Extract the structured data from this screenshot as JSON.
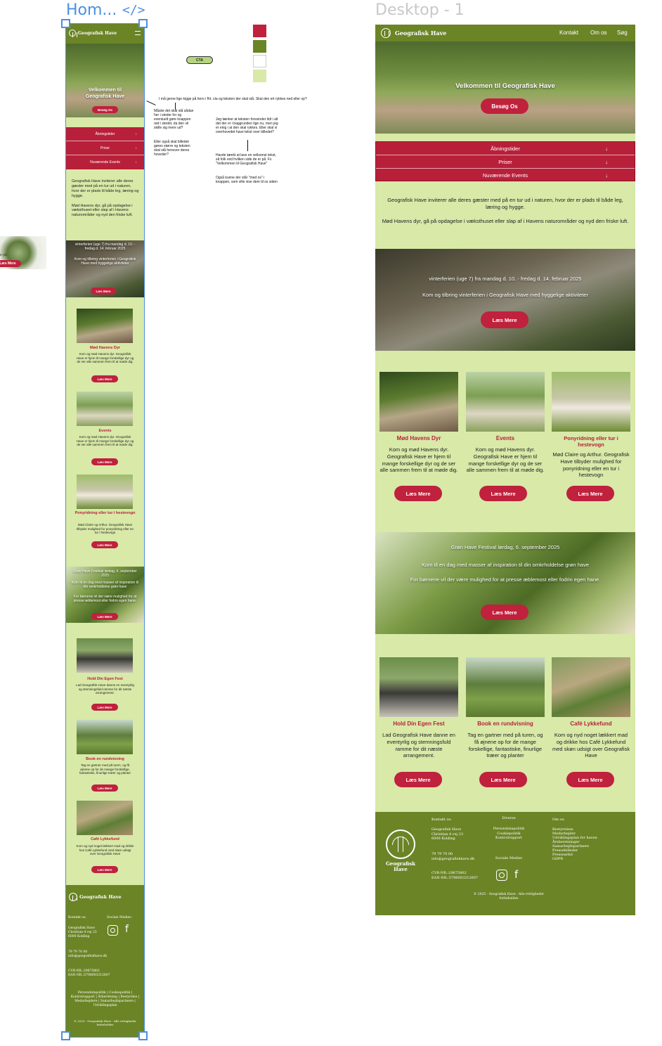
{
  "canvas": {
    "mobile_frame_title": "Hom...",
    "code_icon": "</>",
    "desktop_frame_title": "Desktop - 1",
    "cta_label": "CTA",
    "swatches": [
      "#c0213d",
      "#6b8426",
      "#ffffff",
      "#d8e9a8"
    ],
    "side_thumb_text": "e på",
    "side_thumb_btn": "Læs Mere",
    "notes": {
      "n1": "I må gerne lige kigge på hero i fht. cta og teksten der skal stå. Skal den ert rykkes ned eller op?",
      "n2": "Måske det skal stå sådan her i steder for og eventuelt gøre knappen rød i stedet, da den vil skille sig mere ud?",
      "n3": "Eller også skal billedet gøres større og teksten skal stå henover deres hoveder?",
      "n4": "Jeg tænker at teksten forsvinder lidt i alt det der er i baggrunden lige nu, men jeg er enig i at den skal rykkes. Eller skal vi overhovedet have tekst over billedet?",
      "n5": "Havde tænkt at lave en velkomst tekst, så folk ved hvilken side de er på. Fx \"Velkommen til Geografisk Have\"",
      "n6": "Også kunne der står \"med os\" i knappen, som ville vise dem til os siden"
    }
  },
  "site": {
    "name": "Geografisk Have",
    "nav": [
      "Kontakt",
      "Om os",
      "Søg"
    ],
    "hero_title": "Velkommen til Geografisk Have",
    "hero_button": "Besøg Os",
    "accordions": [
      "Åbningstider",
      "Priser",
      "Nuværende Events"
    ],
    "accordion_arrow": "↓",
    "intro_p1": "Geografisk Have inviterer alle deres gæster med på en tur ud i naturen, hvor der er plads til både leg, læring og hygge.",
    "intro_p2": "Mød Havens dyr, gå på opdagelse i væksthuset eller slap af i Havens naturområder og nyd den friske luft.",
    "banner1": {
      "line1": "vinterferien (uge 7) fra mandag d. 10. - fredag d. 14. februar 2025",
      "line2": "Kom og tilbring vinterferien i Geografisk Have med hyggelige aktiviteter",
      "button": "Læs Mere"
    },
    "banner2": {
      "line1": "Grøn Have Festival lørdag, 6. september 2025",
      "line2": "Kom til en dag med masser af inspiration til din omkrholdelse grøn have",
      "line3": "For børnene vil der være mulighed for at presse æblemost eller fodrin egen hane.",
      "button": "Læs Mere"
    },
    "cards_row1": [
      {
        "title": "Mød Havens Dyr",
        "text": "Kom og mød Havens dyr. Geografisk Have er hjem til mange forskellige dyr og de ser alle sammen frem til at møde dig.",
        "button": "Læs Mere"
      },
      {
        "title": "Events",
        "text": "Kom og mød Havens dyr. Geografisk Have er hjem til mange forskellige dyr og de ser alle sammen frem til at møde dig.",
        "button": "Læs Mere"
      },
      {
        "title": "Ponyridning eller tur i hestevogn",
        "text": "Mød Claire og Arthur. Geografisk Have tilbyder mulighed for ponyridning eller en tur i hestevogn",
        "button": "Læs Mere"
      }
    ],
    "cards_row2": [
      {
        "title": "Hold Din Egen Fest",
        "text": "Lad Geografisk Have danne en eventyrlig og stemningsfuld ramme for dit næste arrangement.",
        "button": "Læs Mere"
      },
      {
        "title": "Book en rundvisning",
        "text": "Tag en gartner med på turen, og få øjnene op for de mange forskellige, fantastiske, finurlige træer og planter",
        "button": "Læs Mere"
      },
      {
        "title": "Café Lykkefund",
        "text": "Kom og nyd noget lækkert mad og drikke hos Café Lykkefund med skøn udsigt over Geografisk Have",
        "button": "Læs Mere"
      }
    ],
    "footer": {
      "contact_heading": "Kontakt os:",
      "address": [
        "Geografisk Have",
        "Christian 4 vej 23",
        "6000 Kolding"
      ],
      "phone": "79 79 70 00",
      "email": "info@geografiskhave.dk",
      "cvr": "CVR-NR.:29675802",
      "ean": "EAN-NR.:5798003312607",
      "misc_heading": "Diverse",
      "misc_links": [
        "Persondatapolitik",
        "Cookiepolitik",
        "Kontrolrapport"
      ],
      "social_heading": "Sociale Medier",
      "about_heading": "Om os:",
      "about_links": [
        "Bestyrelsen",
        "Medarbejder",
        "Udviklingsplan for haven",
        "Årsberetninger",
        "Samarbejdspartnere",
        "Pressebilleder",
        "Pressearkiv",
        "GDPR"
      ],
      "mobile_social_heading": "Sociale Medier:",
      "mobile_links": "Persondatapolitik | Cookiepolitik | Kontrolrapport | Årberetning | Bestyrelse | Medarbejdere | Samarbejdspartnere | Udviklingsplan",
      "copyright": "© 2025 - Geografisk Have - Alle rettigheder forbeholdes",
      "logo_text": "Geografisk Have"
    }
  }
}
